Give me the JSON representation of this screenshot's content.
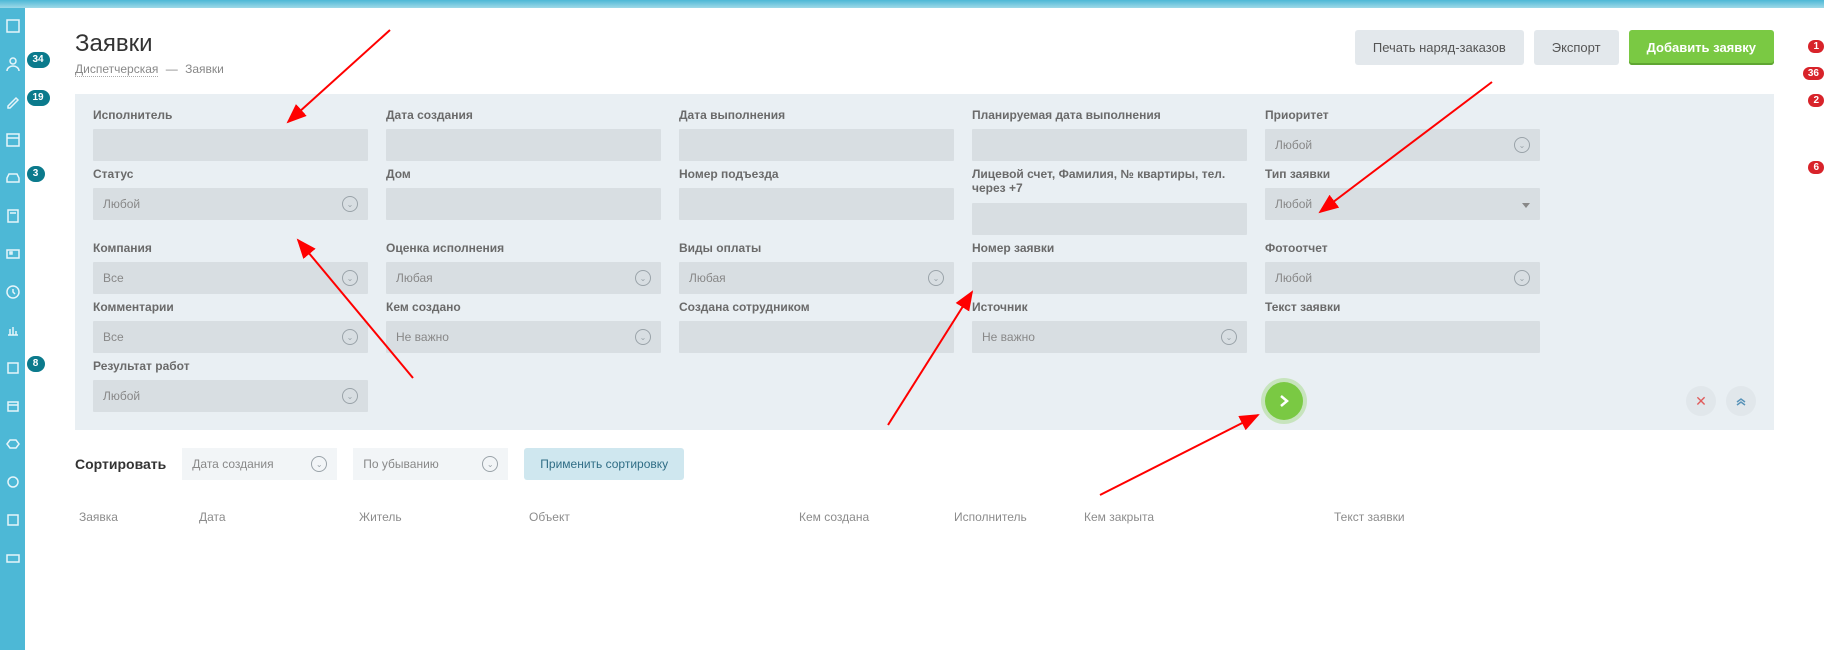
{
  "header": {
    "title": "Заявки",
    "breadcrumb_root": "Диспетчерская",
    "breadcrumb_sep": "—",
    "breadcrumb_current": "Заявки",
    "btn_print": "Печать наряд-заказов",
    "btn_export": "Экспорт",
    "btn_add": "Добавить заявку"
  },
  "sidebar_badges": {
    "b1": "34",
    "b2": "19",
    "b3": "3",
    "b4": "8"
  },
  "right_badges": {
    "r1": "1",
    "r2": "36",
    "r3": "2",
    "r4": "6"
  },
  "filters": {
    "executor": {
      "label": "Исполнитель"
    },
    "created": {
      "label": "Дата создания"
    },
    "done_date": {
      "label": "Дата выполнения"
    },
    "planned": {
      "label": "Планируемая дата выполнения"
    },
    "priority": {
      "label": "Приоритет",
      "value": "Любой"
    },
    "status": {
      "label": "Статус",
      "value": "Любой"
    },
    "house": {
      "label": "Дом"
    },
    "entrance": {
      "label": "Номер подъезда"
    },
    "account": {
      "label": "Лицевой счет, Фамилия, № квартиры, тел. через +7"
    },
    "type": {
      "label": "Тип заявки",
      "value": "Любой"
    },
    "company": {
      "label": "Компания",
      "value": "Все"
    },
    "rating": {
      "label": "Оценка исполнения",
      "value": "Любая"
    },
    "payment": {
      "label": "Виды оплаты",
      "value": "Любая"
    },
    "number": {
      "label": "Номер заявки"
    },
    "photo": {
      "label": "Фотоотчет",
      "value": "Любой"
    },
    "comments": {
      "label": "Комментарии",
      "value": "Все"
    },
    "created_by": {
      "label": "Кем создано",
      "value": "Не важно"
    },
    "staff": {
      "label": "Создана сотрудником"
    },
    "source": {
      "label": "Источник",
      "value": "Не важно"
    },
    "text": {
      "label": "Текст заявки"
    },
    "result": {
      "label": "Результат работ",
      "value": "Любой"
    }
  },
  "sort": {
    "label": "Сортировать",
    "field": "Дата создания",
    "dir": "По убыванию",
    "apply": "Применить сортировку"
  },
  "table": {
    "cols": {
      "app": "Заявка",
      "date": "Дата",
      "resident": "Житель",
      "object": "Объект",
      "creator": "Кем создана",
      "executor": "Исполнитель",
      "closed": "Кем закрыта",
      "text": "Текст заявки"
    }
  }
}
